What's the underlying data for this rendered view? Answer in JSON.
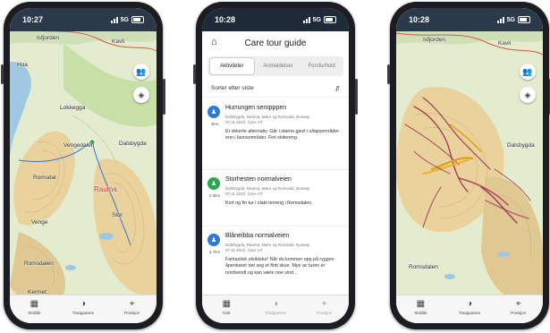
{
  "phone_left": {
    "status_time": "10:27",
    "status_network": "5G",
    "map_labels": {
      "isfjorden": "Isfjorden",
      "kavli": "Kavli",
      "hoa": "Hoa",
      "lokkegga": "Lokkegga",
      "vengedalen": "Vengedalen",
      "dalsbygda": "Dalsbygda",
      "romsdal": "Romsdal",
      "rauma": "Rauma",
      "venge": "Venge",
      "stor": "Stor",
      "romsdalen": "Romsdalen",
      "kermet": "Kermet"
    },
    "map_buttons": [
      "people-icon",
      "layers-icon"
    ],
    "tabs": [
      {
        "icon": "map-icon",
        "label": "Stridde",
        "muted": false
      },
      {
        "icon": "half-circle-icon",
        "label": "Tranguanne",
        "muted": false
      },
      {
        "icon": "target-icon",
        "label": "Posisjon",
        "muted": false
      }
    ]
  },
  "phone_middle": {
    "status_time": "10:28",
    "status_network": "5G",
    "title": "Care tour guide",
    "tabs": [
      "Aktiviteter",
      "Anmeldelser",
      "Forsfurhold"
    ],
    "active_tab": "Aktiviteter",
    "sort_label": "Sorter etter siste",
    "activities": [
      {
        "title": "Hurrungen seropppen",
        "distance": "4km",
        "badge_color": "#2f7ad6",
        "location": "Dalsbygda, Rauma, Møre og Romsdal, Norway",
        "meta": "07.11.2023, Care UT",
        "description": "Et okkerte alternativ. Går i starne gjezl i ullapsområder enn i laonsområder. Fint skitereng."
      },
      {
        "title": "Storhesten normalveien",
        "distance": "2.6km",
        "badge_color": "#2aa84a",
        "location": "Dalsbygda, Rauma, Møre og Romsdal, Norway",
        "meta": "07.11.2023, Care UT",
        "description": "Kort og fin tur i slakt terreng i Romsdalen."
      },
      {
        "title": "Blåneibba normalveien",
        "distance": "3.7km",
        "badge_color": "#2f7ad6",
        "location": "Dalsbygda, Rauma, Møre og Romsdal, Norway",
        "meta": "07.11.2023, Care UT",
        "description": "Fantastisk utsiktstur! Når du kommer opp på ryggen åpenbarer det seg et flott skue. Mye av turen er nordvendt og kan være noe vind..."
      }
    ],
    "tabbar": [
      {
        "icon": "map-icon",
        "label": "Kart",
        "muted": false
      },
      {
        "icon": "half-circle-icon",
        "label": "Tranguanne",
        "muted": true
      },
      {
        "icon": "target-icon",
        "label": "Posisjon",
        "muted": true
      }
    ]
  },
  "phone_right": {
    "status_time": "10:28",
    "status_network": "5G",
    "map_labels": {
      "isfjorden": "Isfjorden",
      "kavli": "Kavli",
      "dalsbygda": "Dalsbygda",
      "romsdalen": "Romsdalen"
    },
    "map_buttons": [
      "people-icon",
      "layers-icon"
    ],
    "tabs": [
      {
        "icon": "map-icon",
        "label": "Stridde",
        "muted": false
      },
      {
        "icon": "half-circle-icon",
        "label": "Tranguanne",
        "muted": false
      },
      {
        "icon": "target-icon",
        "label": "Posisjon",
        "muted": false
      }
    ]
  }
}
